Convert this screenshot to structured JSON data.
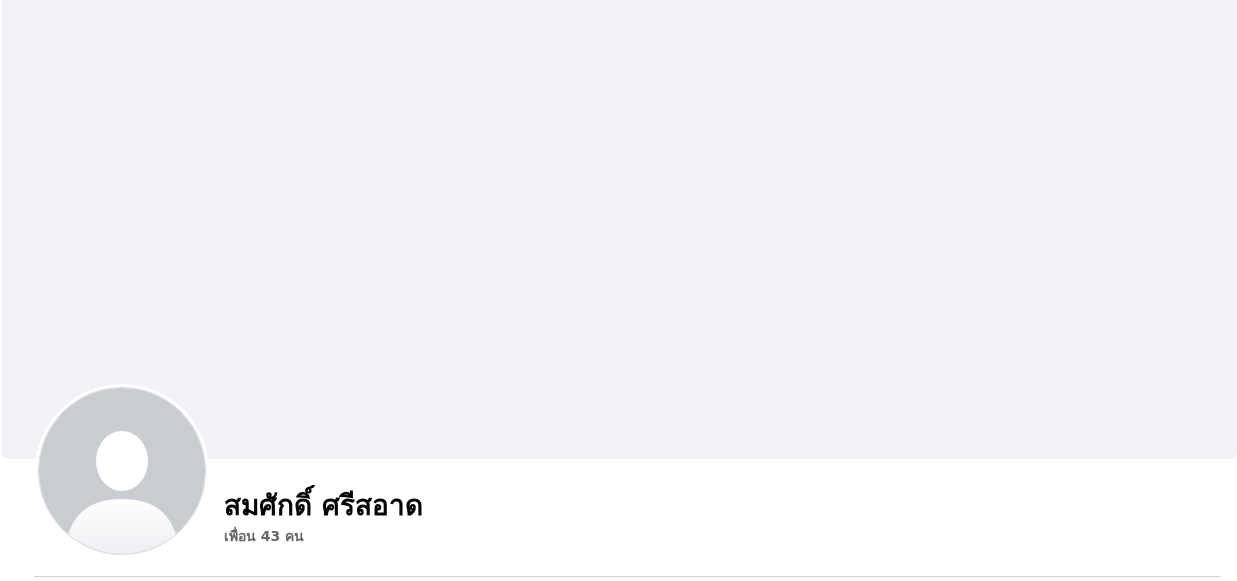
{
  "profile": {
    "name": "สมศักดิ์ ศรีสอาด",
    "friends": "เพื่อน 43 คน"
  }
}
